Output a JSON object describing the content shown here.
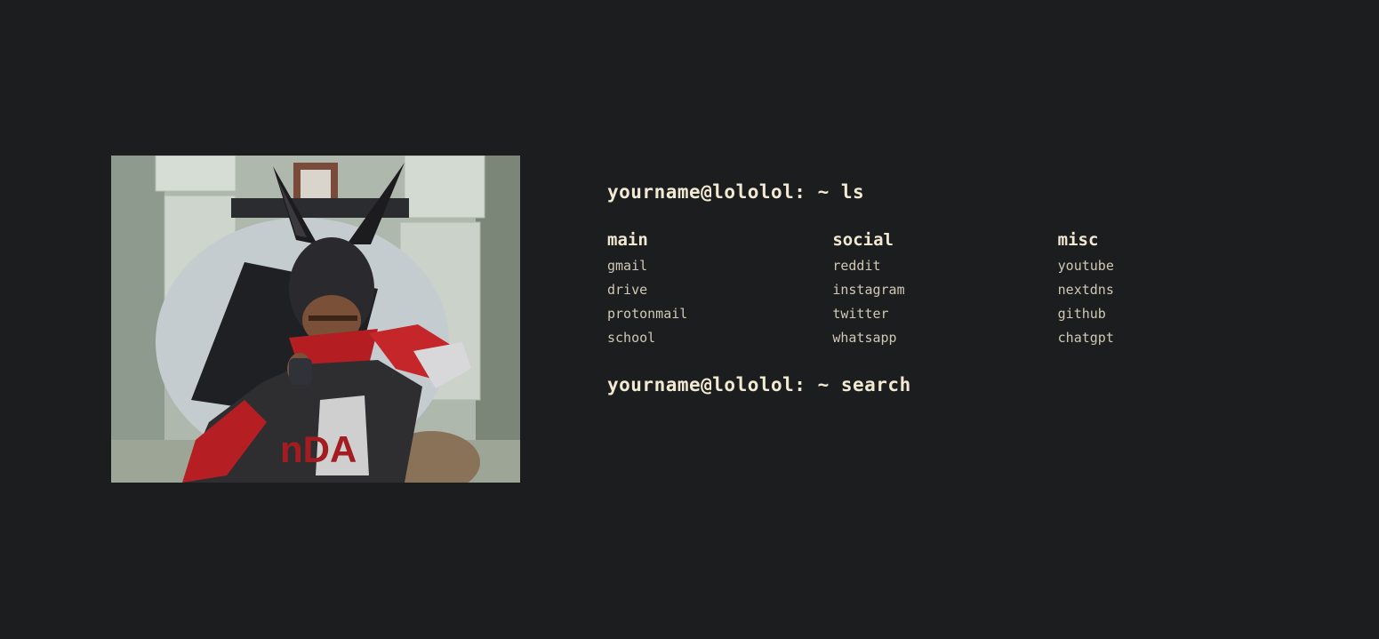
{
  "image": {
    "description_name": "cartoon-avatar-photo"
  },
  "terminal": {
    "prompt_ls": "yourname@lololol: ~ ls",
    "prompt_search": "yourname@lololol: ~ search",
    "columns": [
      {
        "title": "main",
        "links": [
          "gmail",
          "drive",
          "protonmail",
          "school"
        ]
      },
      {
        "title": "social",
        "links": [
          "reddit",
          "instagram",
          "twitter",
          "whatsapp"
        ]
      },
      {
        "title": "misc",
        "links": [
          "youtube",
          "nextdns",
          "github",
          "chatgpt"
        ]
      }
    ]
  },
  "colors": {
    "background": "#1c1d1f",
    "heading": "#f1e9d2",
    "link": "#cfc8b4"
  }
}
